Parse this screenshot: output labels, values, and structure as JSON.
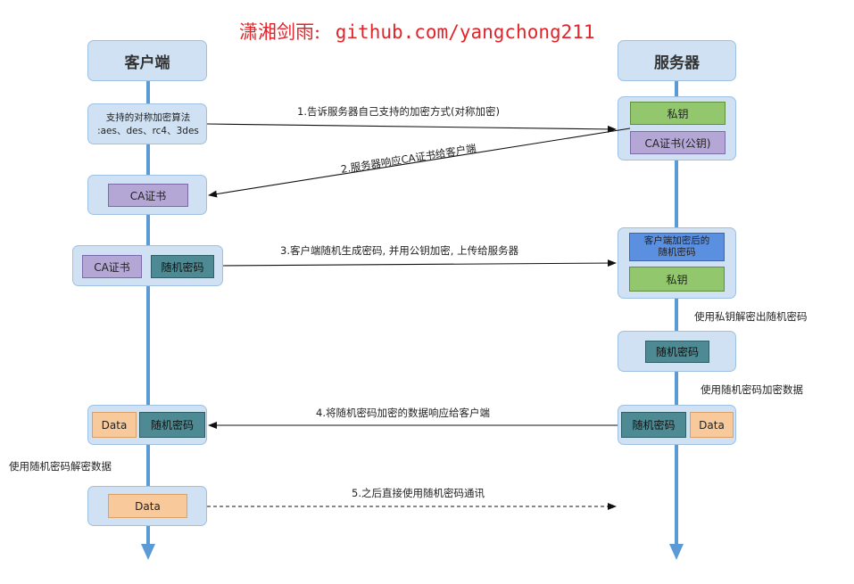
{
  "header": {
    "name": "潇湘剑雨:",
    "url": "github.com/yangchong211"
  },
  "lanes": {
    "client": "客户端",
    "server": "服务器"
  },
  "client": {
    "algorithms": {
      "line1": "支持的对称加密算法",
      "line2": ":aes、des、rc4、3des"
    },
    "ca_cert": "CA证书",
    "ca_cert_2": "CA证书",
    "random_key": "随机密码",
    "data": "Data",
    "random_key_2": "随机密码",
    "decrypt_note": "使用随机密码解密数据",
    "data_2": "Data"
  },
  "server": {
    "private_key": "私钥",
    "ca_cert_pub": "CA证书(公钥)",
    "encrypted_random": {
      "line1": "客户端加密后的",
      "line2": "随机密码"
    },
    "private_key_2": "私钥",
    "decrypt_note": "使用私钥解密出随机密码",
    "random_key": "随机密码",
    "encrypt_note": "使用随机密码加密数据",
    "random_key_2": "随机密码",
    "data": "Data"
  },
  "steps": {
    "s1": "1.告诉服务器自己支持的加密方式(对称加密)",
    "s2": "2.服务器响应CA证书给客户端",
    "s3": "3.客户端随机生成密码, 并用公钥加密, 上传给服务器",
    "s4": "4.将随机密码加密的数据响应给客户端",
    "s5": "5.之后直接使用随机密码通讯"
  },
  "colors": {
    "lane": "#5b9bd5",
    "panel": "#cfe1f3",
    "green": "#92c76e",
    "purple": "#b4a7d6",
    "teal": "#4d8a93",
    "blue": "#5b8fe0",
    "peach": "#f8c99a",
    "header_text": "#e0242a"
  }
}
